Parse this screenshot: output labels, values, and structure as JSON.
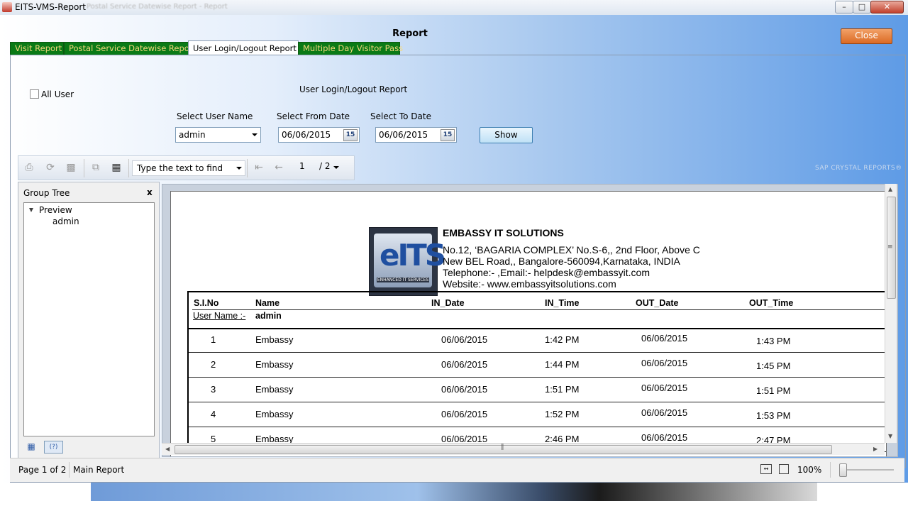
{
  "window": {
    "title": "EITS-VMS-Report",
    "ghost_title": "Postal Service Datewise Report - Report",
    "min_label": "–",
    "max_label": "□",
    "close_label": "✕"
  },
  "header": {
    "title": "Report",
    "close_button": "Close"
  },
  "tabs": [
    {
      "label": "Visit Report",
      "active": false
    },
    {
      "label": "Postal Service Datewise Report",
      "active": false
    },
    {
      "label": "User Login/Logout Report",
      "active": true
    },
    {
      "label": "Multiple Day Visitor Pass",
      "active": false
    }
  ],
  "filters": {
    "all_user_label": "All User",
    "all_user_checked": false,
    "section_title": "User Login/Logout Report",
    "user_label": "Select User Name",
    "user_value": "admin",
    "from_label": "Select From Date",
    "from_value": "06/06/2015",
    "to_label": "Select To Date",
    "to_value": "06/06/2015",
    "calendar_icon_text": "15",
    "show_button": "Show"
  },
  "toolbar": {
    "find_placeholder": "Type the text to find",
    "page_number": "1",
    "page_total": "/ 2",
    "brand": "SAP CRYSTAL REPORTS®"
  },
  "group_tree": {
    "title": "Group Tree",
    "close_label": "x",
    "root": "Preview",
    "child": "admin",
    "help_label": "(?)"
  },
  "report": {
    "logo_text": "eITS",
    "logo_sub": "ENHANCED IT SERVICES",
    "company": "EMBASSY IT SOLUTIONS",
    "address_line1": "No.12, ‘BAGARIA COMPLEX’ No.S-6,, 2nd Floor, Above C",
    "address_line2": "New BEL Road,, Bangalore-560094,Karnataka, INDIA",
    "telephone": "Telephone:- ,Email:- helpdesk@embassyit.com",
    "website": "Website:- www.embassyitsolutions.com",
    "columns": [
      "S.I.No",
      "Name",
      "IN_Date",
      "IN_Time",
      "OUT_Date",
      "OUT_Time"
    ],
    "group_label": "User Name   :-",
    "group_value": "admin",
    "rows": [
      {
        "sno": "1",
        "name": "Embassy",
        "in_date": "06/06/2015",
        "in_time": "1:42 PM",
        "out_date": "06/06/2015",
        "out_time": "1:43 PM"
      },
      {
        "sno": "2",
        "name": "Embassy",
        "in_date": "06/06/2015",
        "in_time": "1:44 PM",
        "out_date": "06/06/2015",
        "out_time": "1:45 PM"
      },
      {
        "sno": "3",
        "name": "Embassy",
        "in_date": "06/06/2015",
        "in_time": "1:51 PM",
        "out_date": "06/06/2015",
        "out_time": "1:51 PM"
      },
      {
        "sno": "4",
        "name": "Embassy",
        "in_date": "06/06/2015",
        "in_time": "1:52 PM",
        "out_date": "06/06/2015",
        "out_time": "1:53 PM"
      },
      {
        "sno": "5",
        "name": "Embassy",
        "in_date": "06/06/2015",
        "in_time": "2:46 PM",
        "out_date": "06/06/2015",
        "out_time": "2:47 PM"
      }
    ]
  },
  "status_bar": {
    "page_info": "Page 1 of 2",
    "section": "Main Report",
    "zoom": "100%"
  }
}
